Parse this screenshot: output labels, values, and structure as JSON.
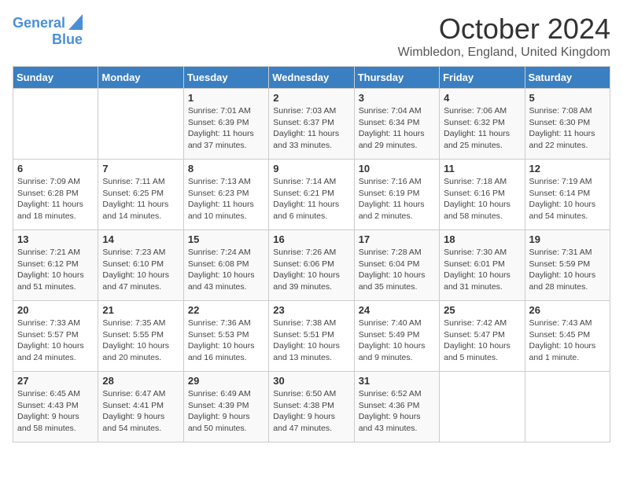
{
  "logo": {
    "line1": "General",
    "line2": "Blue"
  },
  "title": "October 2024",
  "location": "Wimbledon, England, United Kingdom",
  "days_of_week": [
    "Sunday",
    "Monday",
    "Tuesday",
    "Wednesday",
    "Thursday",
    "Friday",
    "Saturday"
  ],
  "weeks": [
    [
      null,
      null,
      {
        "day": "1",
        "sunrise": "Sunrise: 7:01 AM",
        "sunset": "Sunset: 6:39 PM",
        "daylight": "Daylight: 11 hours and 37 minutes."
      },
      {
        "day": "2",
        "sunrise": "Sunrise: 7:03 AM",
        "sunset": "Sunset: 6:37 PM",
        "daylight": "Daylight: 11 hours and 33 minutes."
      },
      {
        "day": "3",
        "sunrise": "Sunrise: 7:04 AM",
        "sunset": "Sunset: 6:34 PM",
        "daylight": "Daylight: 11 hours and 29 minutes."
      },
      {
        "day": "4",
        "sunrise": "Sunrise: 7:06 AM",
        "sunset": "Sunset: 6:32 PM",
        "daylight": "Daylight: 11 hours and 25 minutes."
      },
      {
        "day": "5",
        "sunrise": "Sunrise: 7:08 AM",
        "sunset": "Sunset: 6:30 PM",
        "daylight": "Daylight: 11 hours and 22 minutes."
      }
    ],
    [
      {
        "day": "6",
        "sunrise": "Sunrise: 7:09 AM",
        "sunset": "Sunset: 6:28 PM",
        "daylight": "Daylight: 11 hours and 18 minutes."
      },
      {
        "day": "7",
        "sunrise": "Sunrise: 7:11 AM",
        "sunset": "Sunset: 6:25 PM",
        "daylight": "Daylight: 11 hours and 14 minutes."
      },
      {
        "day": "8",
        "sunrise": "Sunrise: 7:13 AM",
        "sunset": "Sunset: 6:23 PM",
        "daylight": "Daylight: 11 hours and 10 minutes."
      },
      {
        "day": "9",
        "sunrise": "Sunrise: 7:14 AM",
        "sunset": "Sunset: 6:21 PM",
        "daylight": "Daylight: 11 hours and 6 minutes."
      },
      {
        "day": "10",
        "sunrise": "Sunrise: 7:16 AM",
        "sunset": "Sunset: 6:19 PM",
        "daylight": "Daylight: 11 hours and 2 minutes."
      },
      {
        "day": "11",
        "sunrise": "Sunrise: 7:18 AM",
        "sunset": "Sunset: 6:16 PM",
        "daylight": "Daylight: 10 hours and 58 minutes."
      },
      {
        "day": "12",
        "sunrise": "Sunrise: 7:19 AM",
        "sunset": "Sunset: 6:14 PM",
        "daylight": "Daylight: 10 hours and 54 minutes."
      }
    ],
    [
      {
        "day": "13",
        "sunrise": "Sunrise: 7:21 AM",
        "sunset": "Sunset: 6:12 PM",
        "daylight": "Daylight: 10 hours and 51 minutes."
      },
      {
        "day": "14",
        "sunrise": "Sunrise: 7:23 AM",
        "sunset": "Sunset: 6:10 PM",
        "daylight": "Daylight: 10 hours and 47 minutes."
      },
      {
        "day": "15",
        "sunrise": "Sunrise: 7:24 AM",
        "sunset": "Sunset: 6:08 PM",
        "daylight": "Daylight: 10 hours and 43 minutes."
      },
      {
        "day": "16",
        "sunrise": "Sunrise: 7:26 AM",
        "sunset": "Sunset: 6:06 PM",
        "daylight": "Daylight: 10 hours and 39 minutes."
      },
      {
        "day": "17",
        "sunrise": "Sunrise: 7:28 AM",
        "sunset": "Sunset: 6:04 PM",
        "daylight": "Daylight: 10 hours and 35 minutes."
      },
      {
        "day": "18",
        "sunrise": "Sunrise: 7:30 AM",
        "sunset": "Sunset: 6:01 PM",
        "daylight": "Daylight: 10 hours and 31 minutes."
      },
      {
        "day": "19",
        "sunrise": "Sunrise: 7:31 AM",
        "sunset": "Sunset: 5:59 PM",
        "daylight": "Daylight: 10 hours and 28 minutes."
      }
    ],
    [
      {
        "day": "20",
        "sunrise": "Sunrise: 7:33 AM",
        "sunset": "Sunset: 5:57 PM",
        "daylight": "Daylight: 10 hours and 24 minutes."
      },
      {
        "day": "21",
        "sunrise": "Sunrise: 7:35 AM",
        "sunset": "Sunset: 5:55 PM",
        "daylight": "Daylight: 10 hours and 20 minutes."
      },
      {
        "day": "22",
        "sunrise": "Sunrise: 7:36 AM",
        "sunset": "Sunset: 5:53 PM",
        "daylight": "Daylight: 10 hours and 16 minutes."
      },
      {
        "day": "23",
        "sunrise": "Sunrise: 7:38 AM",
        "sunset": "Sunset: 5:51 PM",
        "daylight": "Daylight: 10 hours and 13 minutes."
      },
      {
        "day": "24",
        "sunrise": "Sunrise: 7:40 AM",
        "sunset": "Sunset: 5:49 PM",
        "daylight": "Daylight: 10 hours and 9 minutes."
      },
      {
        "day": "25",
        "sunrise": "Sunrise: 7:42 AM",
        "sunset": "Sunset: 5:47 PM",
        "daylight": "Daylight: 10 hours and 5 minutes."
      },
      {
        "day": "26",
        "sunrise": "Sunrise: 7:43 AM",
        "sunset": "Sunset: 5:45 PM",
        "daylight": "Daylight: 10 hours and 1 minute."
      }
    ],
    [
      {
        "day": "27",
        "sunrise": "Sunrise: 6:45 AM",
        "sunset": "Sunset: 4:43 PM",
        "daylight": "Daylight: 9 hours and 58 minutes."
      },
      {
        "day": "28",
        "sunrise": "Sunrise: 6:47 AM",
        "sunset": "Sunset: 4:41 PM",
        "daylight": "Daylight: 9 hours and 54 minutes."
      },
      {
        "day": "29",
        "sunrise": "Sunrise: 6:49 AM",
        "sunset": "Sunset: 4:39 PM",
        "daylight": "Daylight: 9 hours and 50 minutes."
      },
      {
        "day": "30",
        "sunrise": "Sunrise: 6:50 AM",
        "sunset": "Sunset: 4:38 PM",
        "daylight": "Daylight: 9 hours and 47 minutes."
      },
      {
        "day": "31",
        "sunrise": "Sunrise: 6:52 AM",
        "sunset": "Sunset: 4:36 PM",
        "daylight": "Daylight: 9 hours and 43 minutes."
      },
      null,
      null
    ]
  ]
}
